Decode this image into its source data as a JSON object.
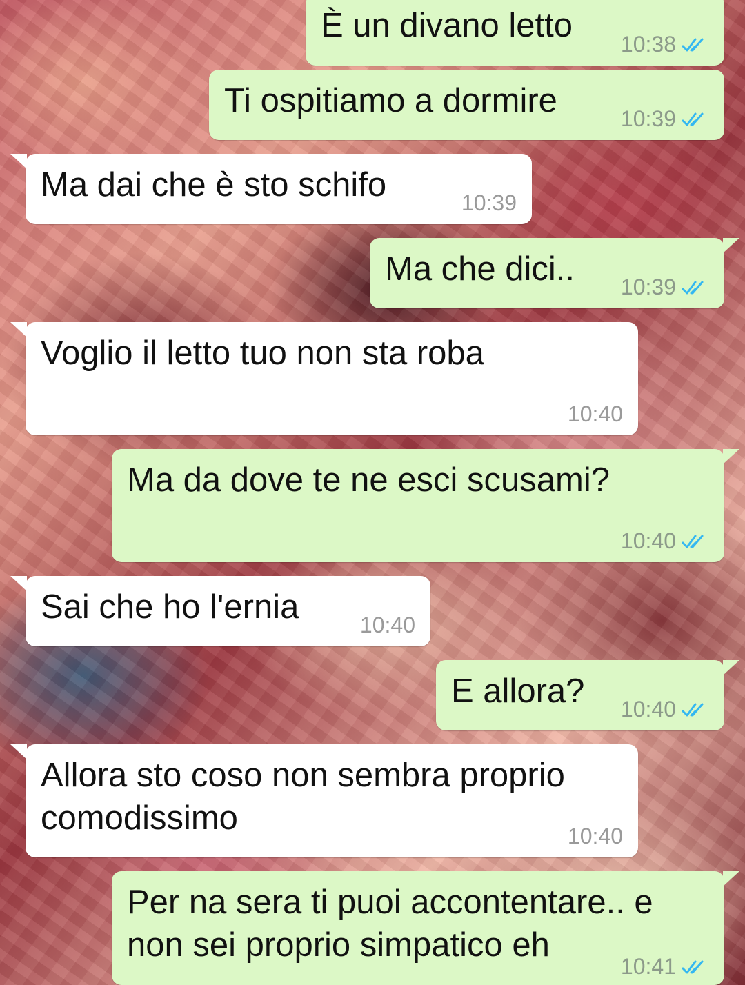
{
  "messages": [
    {
      "id": 1,
      "direction": "out",
      "text": "È un divano letto",
      "time": "10:38",
      "status": "read"
    },
    {
      "id": 2,
      "direction": "out",
      "text": "Ti ospitiamo a dormire",
      "time": "10:39",
      "status": "read"
    },
    {
      "id": 3,
      "direction": "in",
      "text": "Ma dai che è sto schifo",
      "time": "10:39"
    },
    {
      "id": 4,
      "direction": "out",
      "text": "Ma che dici..",
      "time": "10:39",
      "status": "read"
    },
    {
      "id": 5,
      "direction": "in",
      "text": "Voglio il letto tuo non sta roba",
      "time": "10:40"
    },
    {
      "id": 6,
      "direction": "out",
      "text": "Ma da dove te ne esci scusami?",
      "time": "10:40",
      "status": "read"
    },
    {
      "id": 7,
      "direction": "in",
      "text": "Sai che ho l'ernia",
      "time": "10:40"
    },
    {
      "id": 8,
      "direction": "out",
      "text": "E allora?",
      "time": "10:40",
      "status": "read"
    },
    {
      "id": 9,
      "direction": "in",
      "text": "Allora sto coso non sembra proprio comodissimo",
      "time": "10:40"
    },
    {
      "id": 10,
      "direction": "out",
      "text": "Per na sera ti puoi accontentare.. e non sei proprio simpatico eh",
      "time": "10:41",
      "status": "read"
    }
  ],
  "icons": {
    "read_receipt": "double-check-icon"
  },
  "colors": {
    "outgoing_bubble": "#dcf8c6",
    "incoming_bubble": "#ffffff",
    "read_ticks": "#34b7f1"
  }
}
